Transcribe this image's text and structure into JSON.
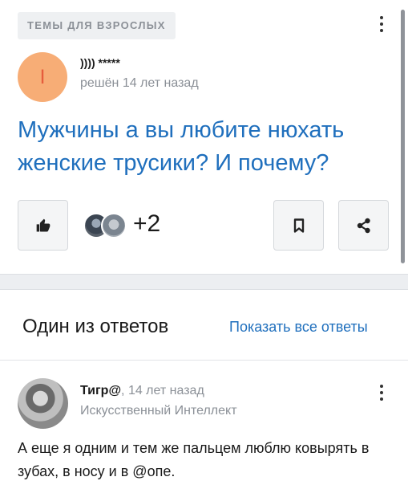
{
  "question_card": {
    "category": "ТЕМЫ ДЛЯ ВЗРОСЛЫХ",
    "author_initial": "I",
    "author_name": ")))) *****",
    "status": "решён 14 лет назад",
    "title": "Мужчины а вы любите нюхать женские трусики? И почему?",
    "extra_voters": "+2"
  },
  "answers_card": {
    "header": "Один из ответов",
    "show_all_link": "Показать все ответы",
    "answer": {
      "author": "Тигр@",
      "time": ", 14 лет назад",
      "rank": "Искусственный Интеллект",
      "text": "А еще я одним и тем же пальцем люблю ковырять в зубах, в носу и в @опе."
    }
  },
  "icons": [
    "thumbs-up-icon",
    "bookmark-icon",
    "share-icon",
    "more-vertical-icon"
  ],
  "colors": {
    "link": "#1f6fbd",
    "avatar_bg": "#f7ad76",
    "avatar_letter": "#e65d3c",
    "muted": "#8b9097"
  }
}
